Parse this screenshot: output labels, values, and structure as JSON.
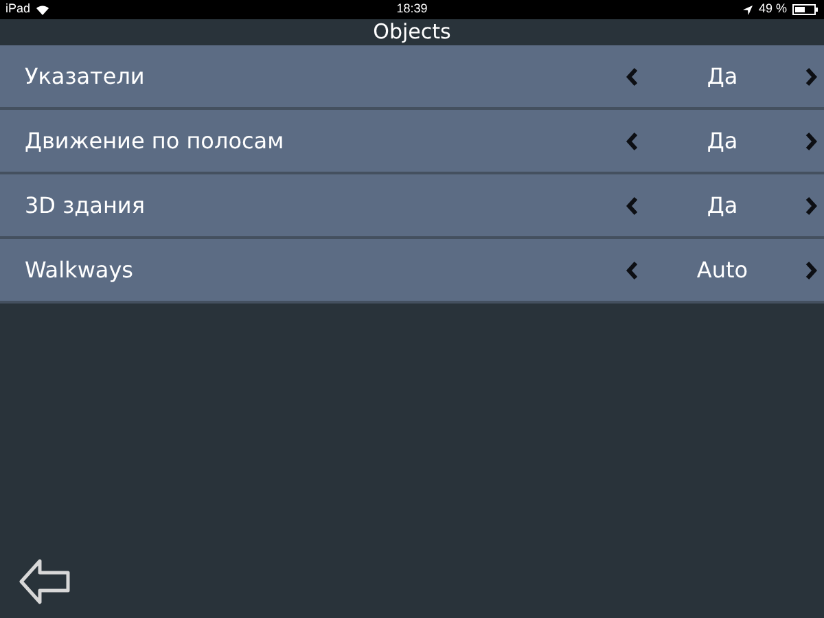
{
  "status_bar": {
    "device": "iPad",
    "time": "18:39",
    "battery": "49 %"
  },
  "title": "Objects",
  "settings": [
    {
      "label": "Указатели",
      "value": "Да"
    },
    {
      "label": "Движение по полосам",
      "value": "Да"
    },
    {
      "label": "3D здания",
      "value": "Да"
    },
    {
      "label": "Walkways",
      "value": "Auto"
    }
  ]
}
